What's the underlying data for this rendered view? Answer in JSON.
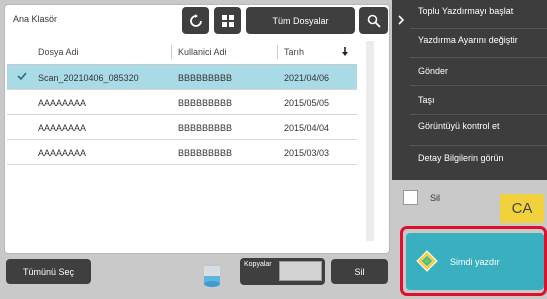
{
  "header": {
    "folder_title": "Ana Klasör",
    "filter_label": "Tüm Dosyalar"
  },
  "table": {
    "columns": [
      "Dosya Adi",
      "Kullanici Adi",
      "Tarıh"
    ],
    "rows": [
      {
        "file": "Scan_20210406_085320",
        "user": "BBBBBBBBB",
        "date": "2021/04/06",
        "selected": true
      },
      {
        "file": "AAAAAAAA",
        "user": "BBBBBBBBB",
        "date": "2015/05/05",
        "selected": false
      },
      {
        "file": "AAAAAAAA",
        "user": "BBBBBBBBB",
        "date": "2015/04/04",
        "selected": false
      },
      {
        "file": "AAAAAAAA",
        "user": "BBBBBBBBB",
        "date": "2015/03/03",
        "selected": false
      }
    ]
  },
  "bottom": {
    "select_all_label": "Tümünü Seç",
    "copies_label": "Kopyalar",
    "copies_value": "",
    "delete_label": "Sil"
  },
  "side_menu": {
    "items": [
      "Toplu Yazdırmayı başlat",
      "Yazdırma Ayarını değiştir",
      "Gönder",
      "Taşı",
      "Görüntüyü kontrol et",
      "Detay Bilgilerin görün"
    ]
  },
  "delete_checkbox_label": "Sil",
  "ca_label": "CA",
  "print_label": "Simdi yazdır",
  "icons": {
    "refresh": "refresh-icon",
    "grid": "grid-view-icon",
    "search": "search-icon",
    "sort": "sort-down-icon",
    "check": "check-icon",
    "toner": "toner-cartridge-icon",
    "collapse": "chevron-right-icon",
    "start": "start-diamond-icon"
  },
  "colors": {
    "selected_row": "#a9dbe6",
    "print_button": "#3aafc0",
    "highlight_frame": "#e0102a",
    "ca_button": "#f1d13c",
    "dark_button": "#3f3f3f"
  }
}
